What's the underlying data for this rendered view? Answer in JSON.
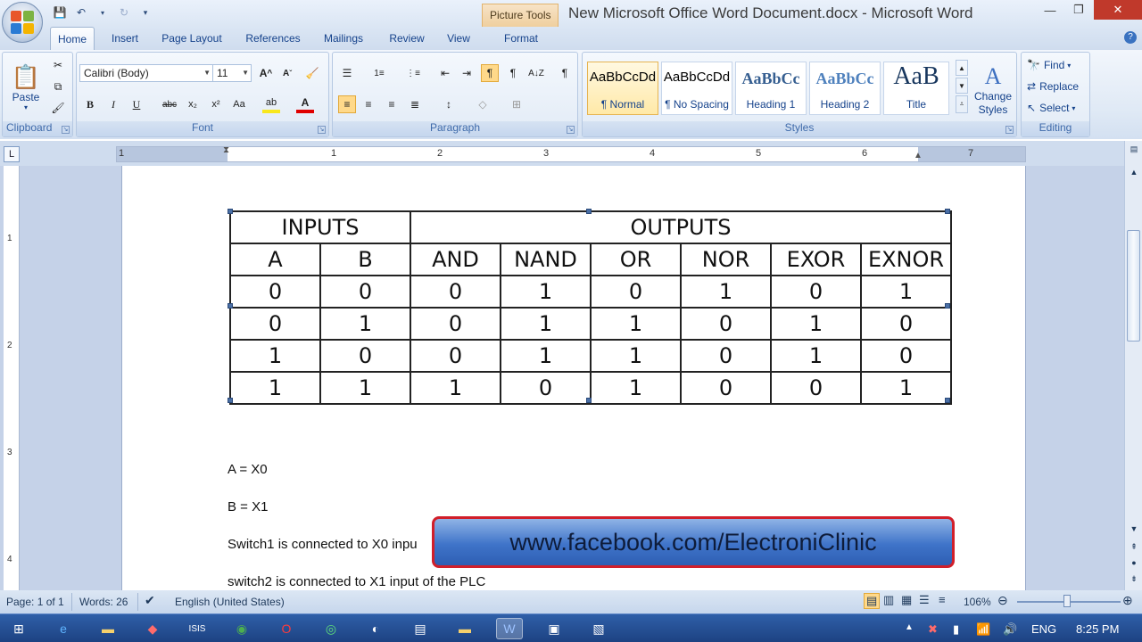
{
  "window": {
    "title": "New Microsoft Office Word Document.docx - Microsoft Word",
    "context_tab": "Picture Tools"
  },
  "tabs": [
    "Home",
    "Insert",
    "Page Layout",
    "References",
    "Mailings",
    "Review",
    "View",
    "Format"
  ],
  "active_tab": "Home",
  "ribbon": {
    "clipboard": {
      "label": "Clipboard",
      "paste": "Paste"
    },
    "font": {
      "label": "Font",
      "name": "Calibri (Body)",
      "size": "11"
    },
    "paragraph": {
      "label": "Paragraph"
    },
    "styles": {
      "label": "Styles",
      "items": [
        {
          "sample": "AaBbCcDd",
          "name": "¶ Normal"
        },
        {
          "sample": "AaBbCcDd",
          "name": "¶ No Spacing"
        },
        {
          "sample": "AaBbCc",
          "name": "Heading 1"
        },
        {
          "sample": "AaBbCc",
          "name": "Heading 2"
        },
        {
          "sample": "AaB",
          "name": "Title"
        }
      ],
      "change_styles": "Change Styles"
    },
    "editing": {
      "label": "Editing",
      "find": "Find",
      "replace": "Replace",
      "select": "Select"
    }
  },
  "ruler_numbers": [
    "1",
    "1",
    "2",
    "3",
    "4",
    "5",
    "6",
    "7"
  ],
  "vruler_numbers": [
    "1",
    "2",
    "3",
    "4"
  ],
  "truth_table": {
    "group_headers": [
      "INPUTS",
      "OUTPUTS"
    ],
    "columns": [
      "A",
      "B",
      "AND",
      "NAND",
      "OR",
      "NOR",
      "EXOR",
      "EXNOR"
    ],
    "rows": [
      [
        "0",
        "0",
        "0",
        "1",
        "0",
        "1",
        "0",
        "1"
      ],
      [
        "0",
        "1",
        "0",
        "1",
        "1",
        "0",
        "1",
        "0"
      ],
      [
        "1",
        "0",
        "0",
        "1",
        "1",
        "0",
        "1",
        "0"
      ],
      [
        "1",
        "1",
        "1",
        "0",
        "1",
        "0",
        "0",
        "1"
      ]
    ]
  },
  "doc_lines": [
    "A = X0",
    "B = X1",
    "Switch1 is connected  to X0 inpu",
    "switch2 is connected  to X1 input of the PLC"
  ],
  "banner": "www.facebook.com/ElectroniClinic",
  "status": {
    "page": "Page: 1 of 1",
    "words": "Words: 26",
    "language": "English (United States)",
    "zoom": "106%"
  },
  "tray": {
    "lang": "ENG",
    "time": "8:25 PM"
  }
}
